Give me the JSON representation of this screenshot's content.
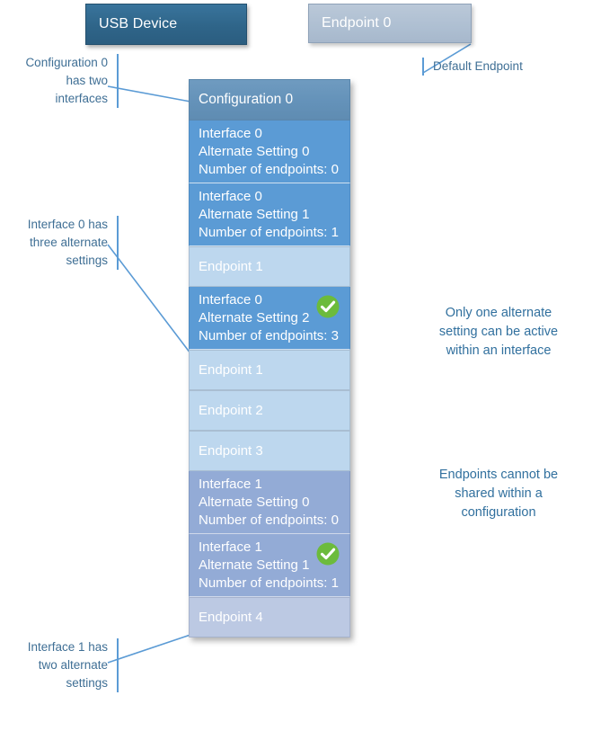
{
  "diagram": {
    "title": "USB Device configuration hierarchy",
    "colors": {
      "device_box": "#2f6589",
      "default_endpoint_box": "#aebfd2",
      "configuration_header": "#6492b9",
      "interface0": "#5b9bd5",
      "interface1": "#93abd6",
      "endpoint": "#bdd7ee",
      "endpoint_muted": "#bcc9e3",
      "check_badge": "#6cbb3c",
      "annotation_text": "#3f6f95",
      "leader_line": "#5b9bd5"
    }
  },
  "top_nodes": {
    "device": {
      "label": "USB Device"
    },
    "default_endpoint": {
      "label": "Endpoint 0"
    }
  },
  "stack": {
    "configuration": {
      "label": "Configuration 0"
    },
    "rows": [
      {
        "kind": "interface",
        "group": "interface0",
        "label": "Interface 0\nAlternate Setting 0\nNumber of endpoints: 0",
        "interface": "Interface 0",
        "alternate_setting": "Alternate Setting 0",
        "endpoint_count_text": "Number of endpoints: 0",
        "endpoint_count": 0,
        "active": false
      },
      {
        "kind": "interface",
        "group": "interface0",
        "label": "Interface 0\nAlternate Setting 1\nNumber of endpoints: 1",
        "interface": "Interface 0",
        "alternate_setting": "Alternate Setting 1",
        "endpoint_count_text": "Number of endpoints: 1",
        "endpoint_count": 1,
        "active": false
      },
      {
        "kind": "endpoint",
        "group": "interface0",
        "label": "Endpoint 1"
      },
      {
        "kind": "interface",
        "group": "interface0",
        "label": "Interface 0\nAlternate Setting 2\nNumber of endpoints: 3",
        "interface": "Interface 0",
        "alternate_setting": "Alternate Setting 2",
        "endpoint_count_text": "Number of endpoints: 3",
        "endpoint_count": 3,
        "active": true
      },
      {
        "kind": "endpoint",
        "group": "interface0",
        "label": "Endpoint 1"
      },
      {
        "kind": "endpoint",
        "group": "interface0",
        "label": "Endpoint 2"
      },
      {
        "kind": "endpoint",
        "group": "interface0",
        "label": "Endpoint 3"
      },
      {
        "kind": "interface",
        "group": "interface1",
        "label": "Interface 1\nAlternate Setting 0\nNumber of endpoints: 0",
        "interface": "Interface 1",
        "alternate_setting": "Alternate Setting 0",
        "endpoint_count_text": "Number of endpoints: 0",
        "endpoint_count": 0,
        "active": false
      },
      {
        "kind": "interface",
        "group": "interface1",
        "label": "Interface 1\nAlternate Setting 1\nNumber of endpoints: 1",
        "interface": "Interface 1",
        "alternate_setting": "Alternate Setting 1",
        "endpoint_count_text": "Number of endpoints: 1",
        "endpoint_count": 1,
        "active": true
      },
      {
        "kind": "endpoint",
        "group": "interface1",
        "label": "Endpoint 4"
      }
    ]
  },
  "annotations": {
    "config": {
      "text": "Configuration 0\nhas two\ninterfaces"
    },
    "interface0": {
      "text": "Interface 0 has\nthree alternate\nsettings"
    },
    "interface1": {
      "text": "Interface 1 has\ntwo alternate\nsettings"
    },
    "default_endpoint": {
      "text": "Default Endpoint"
    },
    "note_alternate": {
      "text": "Only one alternate\nsetting can be active\nwithin an interface"
    },
    "note_endpoints": {
      "text": "Endpoints cannot be\nshared within a\nconfiguration"
    }
  },
  "icons": {
    "check": "check-circle-icon"
  }
}
